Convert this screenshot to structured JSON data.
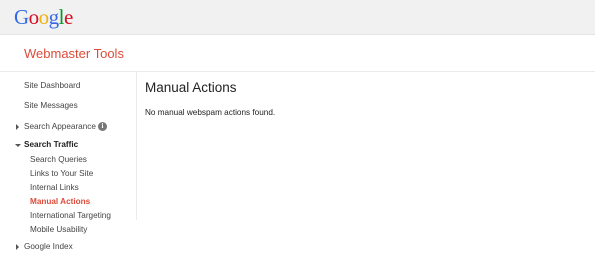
{
  "header": {
    "logo_letters": [
      {
        "char": "G",
        "color": "#3369e8"
      },
      {
        "char": "o",
        "color": "#d50f25"
      },
      {
        "char": "o",
        "color": "#eeb211"
      },
      {
        "char": "g",
        "color": "#3369e8"
      },
      {
        "char": "l",
        "color": "#009925"
      },
      {
        "char": "e",
        "color": "#d50f25"
      }
    ]
  },
  "product": {
    "title": "Webmaster Tools",
    "accent_color": "#dd4b39"
  },
  "sidebar": {
    "site_dashboard": "Site Dashboard",
    "site_messages": "Site Messages",
    "search_appearance": "Search Appearance",
    "info_glyph": "i",
    "search_traffic": "Search Traffic",
    "search_traffic_items": [
      "Search Queries",
      "Links to Your Site",
      "Internal Links",
      "Manual Actions",
      "International Targeting",
      "Mobile Usability"
    ],
    "google_index": "Google Index"
  },
  "main": {
    "title": "Manual Actions",
    "message": "No manual webspam actions found."
  }
}
